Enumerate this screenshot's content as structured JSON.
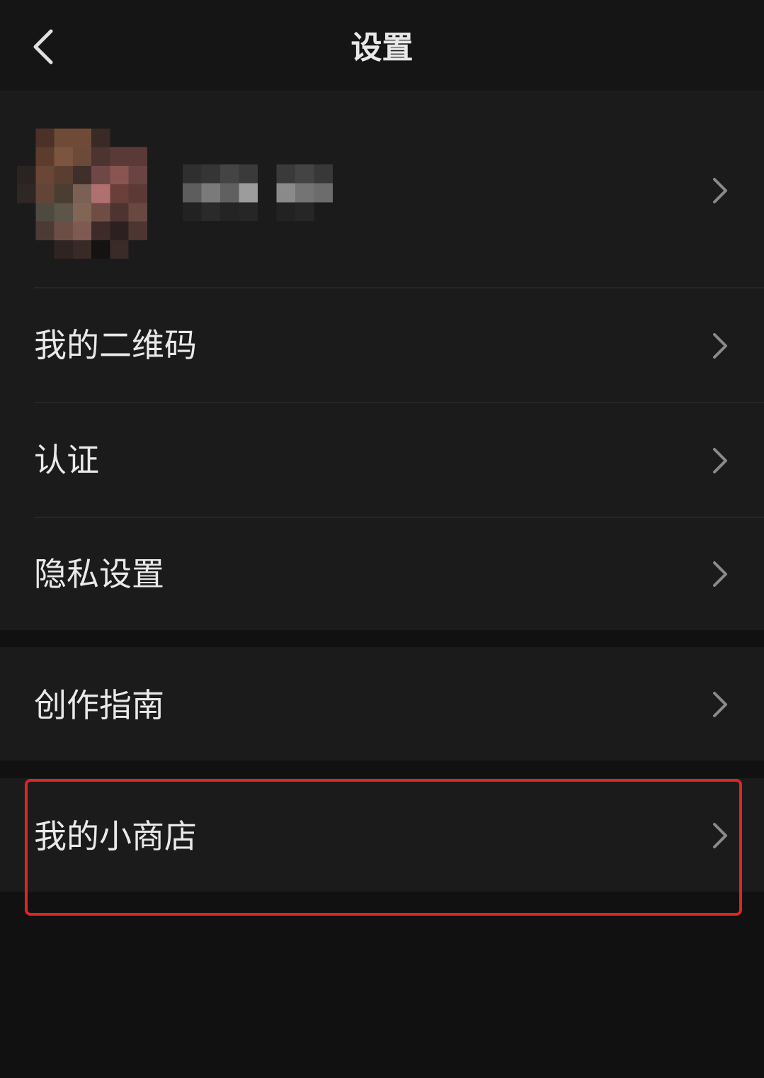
{
  "navbar": {
    "title": "设置",
    "back_icon": "chevron-left-icon"
  },
  "profile": {
    "avatar_icon": "pixelated-avatar",
    "name_icon": "pixelated-name"
  },
  "menu_groups": [
    {
      "items": [
        {
          "label": "我的二维码",
          "icon": "chevron-right-icon"
        },
        {
          "label": "认证",
          "icon": "chevron-right-icon"
        },
        {
          "label": "隐私设置",
          "icon": "chevron-right-icon"
        }
      ]
    },
    {
      "items": [
        {
          "label": "创作指南",
          "icon": "chevron-right-icon"
        }
      ]
    },
    {
      "items": [
        {
          "label": "我的小商店",
          "icon": "chevron-right-icon"
        }
      ]
    }
  ],
  "colors": {
    "background": "#111111",
    "row_background": "#1b1b1b",
    "text": "#e9e9e9",
    "chevron": "#8a8a8a",
    "highlight": "#e02424"
  }
}
